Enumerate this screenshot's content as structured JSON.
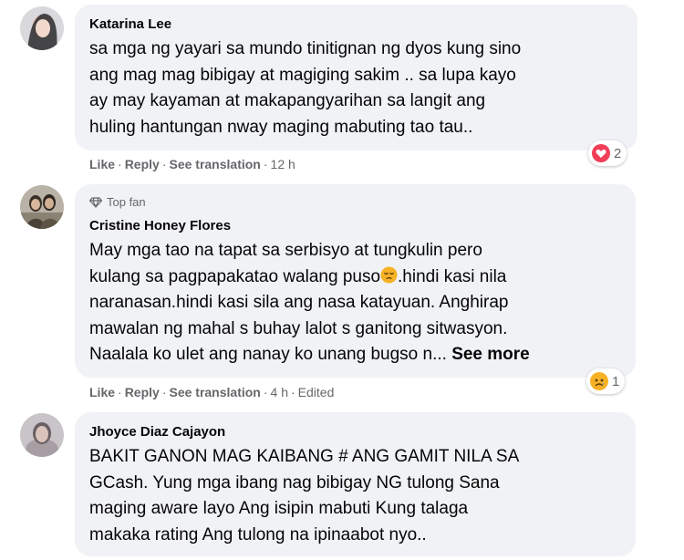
{
  "actions": {
    "like": "Like",
    "reply": "Reply",
    "see_translation": "See translation",
    "separator": "·"
  },
  "comments": [
    {
      "author": "Katarina Lee",
      "lines": [
        "sa mga ng yayari sa mundo tinitignan ng dyos kung sino",
        "ang mag mag bibigay at magiging sakim .. sa lupa kayo",
        "ay may kayaman at makapangyarihan sa langit ang",
        "huling hantungan nway maging mabuting tao tau.."
      ],
      "time": "12 h",
      "reaction": {
        "icon": "heart-reaction-icon",
        "color": "#f33e58",
        "count": "2"
      }
    },
    {
      "badge": "Top fan",
      "author": "Cristine Honey Flores",
      "lines": [
        "May mga tao na tapat sa serbisyo at tungkulin pero",
        "kulang sa pagpapakatao walang puso",
        ".hindi kasi nila",
        "naranasan.hindi kasi sila ang nasa katayuan. Anghirap",
        "mawalan ng mahal s buhay lalot s ganitong sitwasyon.",
        "Naalala ko ulet ang nanay ko unang bugso n..."
      ],
      "see_more": "See more",
      "time": "4 h",
      "edited": "Edited",
      "reaction": {
        "icon": "sad-reaction-icon",
        "color": "#f7b125",
        "count": "1"
      }
    },
    {
      "author": "Jhoyce Diaz Cajayon",
      "lines": [
        "BAKIT GANON MAG KAIBANG # ANG GAMIT NILA SA",
        "GCash. Yung mga ibang nag bibigay NG tulong Sana",
        "maging aware layo Ang isipin mabuti Kung talaga",
        "makaka rating Ang tulong na ipinaabot nyo.."
      ]
    }
  ]
}
